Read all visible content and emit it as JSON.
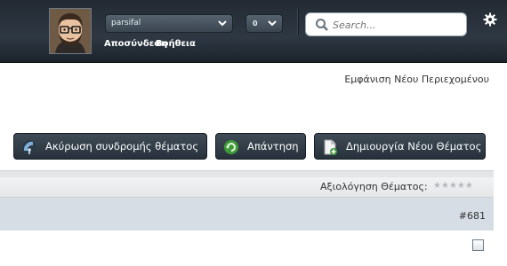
{
  "header": {
    "username": "parsifal",
    "count": "0",
    "logout_label": "Αποσύνδεση",
    "help_label": "Βοήθεια",
    "search_placeholder": "Search...",
    "icons": {
      "search": "search-icon",
      "settings": "gear-icon",
      "dropdown": "chevron-down-icon"
    }
  },
  "page": {
    "new_content_link": "Εμφάνιση Νέου Περιεχομένου"
  },
  "actions": {
    "unsubscribe_label": "Ακύρωση συνδρομής θέματος",
    "reply_label": "Απάντηση",
    "new_topic_label": "Δημιουργία Νέου Θέματος"
  },
  "topic": {
    "rating_label": "Αξιολόγηση Θέματος:",
    "rating_stars": 0,
    "rating_max": 5
  },
  "post": {
    "number": "#681"
  },
  "colors": {
    "topbar": "#2b343e",
    "button": "#323d48",
    "postbar": "#d7dde5"
  }
}
